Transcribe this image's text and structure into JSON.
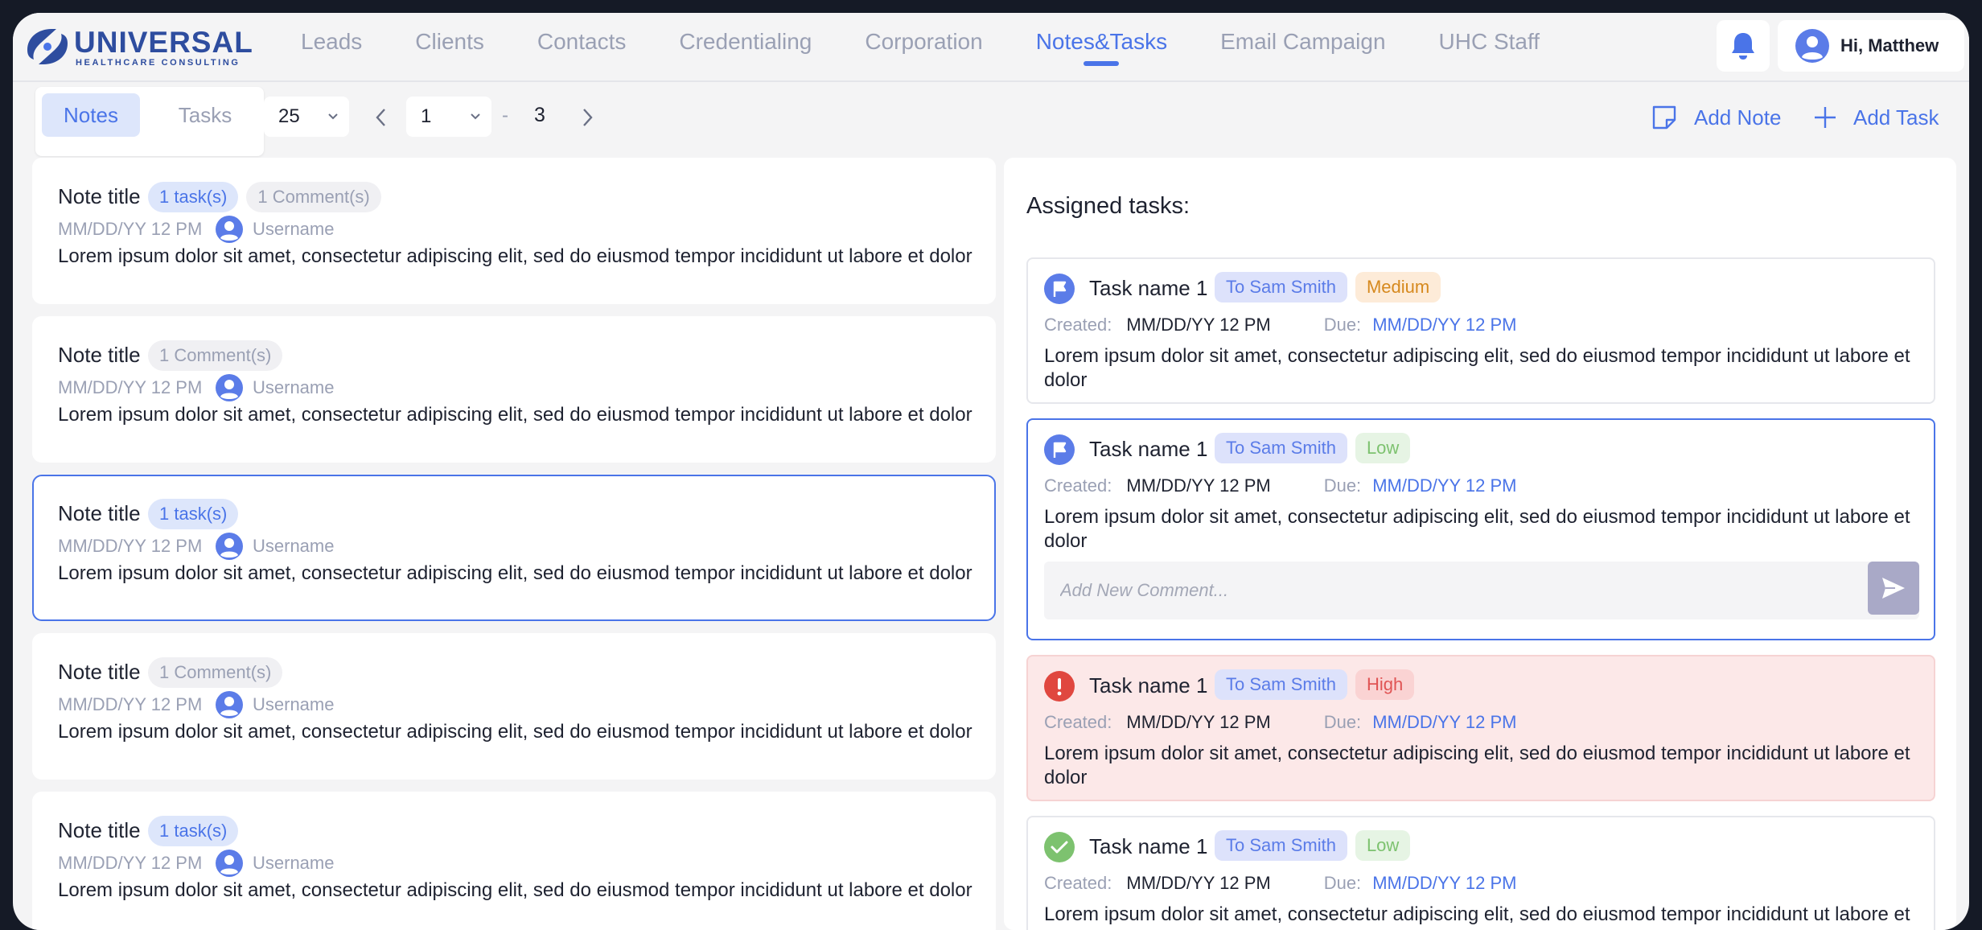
{
  "brand": {
    "name": "UNIVERSAL",
    "sub": "HEALTHCARE CONSULTING"
  },
  "nav": {
    "items": [
      "Leads",
      "Clients",
      "Contacts",
      "Credentialing",
      "Corporation",
      "Notes&Tasks",
      "Email Campaign",
      "UHC Staff"
    ],
    "active": "Notes&Tasks"
  },
  "user": {
    "greeting": "Hi, Matthew"
  },
  "toolbar": {
    "tabs": {
      "notes": "Notes",
      "tasks": "Tasks",
      "active": "Notes"
    },
    "per_page": "25",
    "page": "1",
    "dash": "-",
    "page_total": "3",
    "add_note": "Add Note",
    "add_task": "Add Task"
  },
  "notes": [
    {
      "title": "Note title",
      "badges": [
        {
          "text": "1 task(s)",
          "kind": "task"
        },
        {
          "text": "1 Comment(s)",
          "kind": "comment"
        }
      ],
      "date": "MM/DD/YY 12 PM",
      "user": "Username",
      "body": "Lorem ipsum dolor sit amet, consectetur adipiscing elit, sed do eiusmod tempor incididunt ut labore et dolor",
      "selected": false
    },
    {
      "title": "Note title",
      "badges": [
        {
          "text": "1 Comment(s)",
          "kind": "comment"
        }
      ],
      "date": "MM/DD/YY 12 PM",
      "user": "Username",
      "body": "Lorem ipsum dolor sit amet, consectetur adipiscing elit, sed do eiusmod tempor incididunt ut labore et dolor",
      "selected": false
    },
    {
      "title": "Note title",
      "badges": [
        {
          "text": "1 task(s)",
          "kind": "task"
        }
      ],
      "date": "MM/DD/YY 12 PM",
      "user": "Username",
      "body": "Lorem ipsum dolor sit amet, consectetur adipiscing elit, sed do eiusmod tempor incididunt ut labore et dolor",
      "selected": true
    },
    {
      "title": "Note title",
      "badges": [
        {
          "text": "1 Comment(s)",
          "kind": "comment"
        }
      ],
      "date": "MM/DD/YY 12 PM",
      "user": "Username",
      "body": "Lorem ipsum dolor sit amet, consectetur adipiscing elit, sed do eiusmod tempor incididunt ut labore et dolor",
      "selected": false
    },
    {
      "title": "Note title",
      "badges": [
        {
          "text": "1 task(s)",
          "kind": "task"
        }
      ],
      "date": "MM/DD/YY 12 PM",
      "user": "Username",
      "body": "Lorem ipsum dolor sit amet, consectetur adipiscing elit, sed do eiusmod tempor incididunt ut labore et dolor",
      "selected": false
    }
  ],
  "tasks_panel": {
    "heading": "Assigned tasks:",
    "created_label": "Created:",
    "due_label": "Due:",
    "comment_placeholder": "Add New Comment...",
    "tasks": [
      {
        "name": "Task name 1",
        "assignee": "To Sam Smith",
        "priority": "Medium",
        "icon": "flag-icon",
        "state": "normal",
        "created": "MM/DD/YY 12 PM",
        "due": "MM/DD/YY 12 PM",
        "body": "Lorem ipsum dolor sit amet, consectetur adipiscing elit, sed do eiusmod tempor incididunt ut labore et dolor"
      },
      {
        "name": "Task name 1",
        "assignee": "To Sam Smith",
        "priority": "Low",
        "icon": "flag-icon",
        "state": "active",
        "created": "MM/DD/YY 12 PM",
        "due": "MM/DD/YY 12 PM",
        "body": "Lorem ipsum dolor sit amet, consectetur adipiscing elit, sed do eiusmod tempor incididunt ut labore et dolor"
      },
      {
        "name": "Task name 1",
        "assignee": "To Sam Smith",
        "priority": "High",
        "icon": "alert-icon",
        "state": "high",
        "created": "MM/DD/YY 12 PM",
        "due": "MM/DD/YY 12 PM",
        "body": "Lorem ipsum dolor sit amet, consectetur adipiscing elit, sed do eiusmod tempor incididunt ut labore et dolor"
      },
      {
        "name": "Task name 1",
        "assignee": "To Sam Smith",
        "priority": "Low",
        "icon": "check-icon",
        "state": "normal",
        "created": "MM/DD/YY 12 PM",
        "due": "MM/DD/YY 12 PM",
        "body": "Lorem ipsum dolor sit amet, consectetur adipiscing elit, sed do eiusmod tempor incididunt ut labore et dolor"
      }
    ]
  },
  "colors": {
    "accent": "#4a74e8",
    "brand": "#2e4d9f",
    "high": "#e05454",
    "done": "#7dc26f"
  }
}
